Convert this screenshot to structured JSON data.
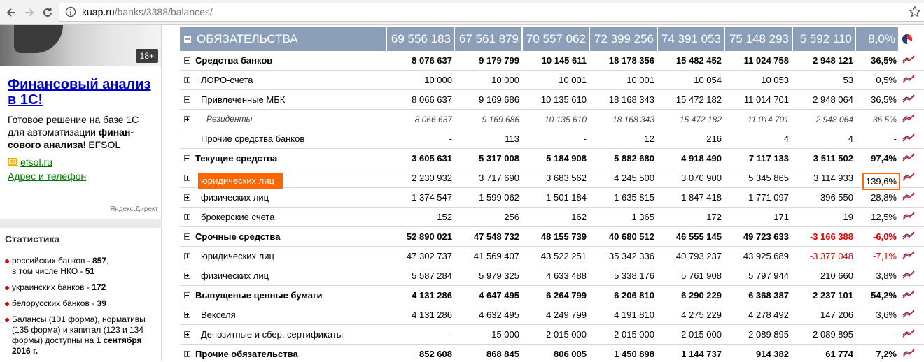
{
  "browser": {
    "url_host": "kuap.ru",
    "url_path": "/banks/3388/balances/"
  },
  "ad": {
    "age_badge": "18+",
    "title": "Финансовый анализ в 1С!",
    "text_1": "Готовое решение на базе 1С для автоматизации ",
    "text_bold": "финан-сового анализа",
    "text_2": "! EFSOL",
    "domain": "efsol.ru",
    "contacts": "Адрес и телефон",
    "label": "Яндекс.Директ"
  },
  "stats": {
    "title": "Статистика",
    "items": [
      {
        "text": "российских банков - ",
        "bold": "857",
        "text2": ",",
        "line2": "в том числе НКО - ",
        "bold2": "51"
      },
      {
        "text": "украинских банков - ",
        "bold": "172"
      },
      {
        "text": "белорусских банков - ",
        "bold": "39"
      },
      {
        "text": "Балансы (101 форма), нормативы (135 форма) и капитал (123 и 134 формы) доступны на ",
        "bold": "1 сентября 2016 г."
      }
    ]
  },
  "table": {
    "header": {
      "title": "ОБЯЗАТЕЛЬСТВА",
      "values": [
        "69 556 183",
        "67 561 879",
        "70 557 062",
        "72 399 256",
        "74 391 053",
        "75 148 293",
        "5 592 110",
        "8,0%"
      ]
    },
    "rows": [
      {
        "label": "Средства банков",
        "values": [
          "8 076 637",
          "9 179 799",
          "10 145 611",
          "18 178 356",
          "15 482 452",
          "11 024 758",
          "2 948 121",
          "36,5%"
        ]
      },
      {
        "label": "ЛОРО-счета",
        "values": [
          "10 000",
          "10 000",
          "10 001",
          "10 001",
          "10 054",
          "10 053",
          "53",
          "0,5%"
        ]
      },
      {
        "label": "Привлеченные МБК",
        "values": [
          "8 066 637",
          "9 169 686",
          "10 135 610",
          "18 168 343",
          "15 472 182",
          "11 014 701",
          "2 948 064",
          "36,5%"
        ]
      },
      {
        "label": "Резиденты",
        "values": [
          "8 066 637",
          "9 169 686",
          "10 135 610",
          "18 168 343",
          "15 472 182",
          "11 014 701",
          "2 948 064",
          "36,5%"
        ]
      },
      {
        "label": "Прочие средства банков",
        "values": [
          "-",
          "113",
          "-",
          "12",
          "216",
          "4",
          "4",
          "-"
        ]
      },
      {
        "label": "Текущие средства",
        "values": [
          "3 605 631",
          "5 317 008",
          "5 184 908",
          "5 882 680",
          "4 918 490",
          "7 117 133",
          "3 511 502",
          "97,4%"
        ]
      },
      {
        "label": "юридических лиц",
        "values": [
          "2 230 932",
          "3 717 690",
          "3 683 562",
          "4 245 500",
          "3 070 900",
          "5 345 865",
          "3 114 933",
          "139,6%"
        ]
      },
      {
        "label": "физических лиц",
        "values": [
          "1 374 547",
          "1 599 062",
          "1 501 184",
          "1 635 815",
          "1 847 418",
          "1 771 097",
          "396 550",
          "28,8%"
        ]
      },
      {
        "label": "брокерские счета",
        "values": [
          "152",
          "256",
          "162",
          "1 365",
          "172",
          "171",
          "19",
          "12,5%"
        ]
      },
      {
        "label": "Срочные средства",
        "values": [
          "52 890 021",
          "47 548 732",
          "48 155 739",
          "40 680 512",
          "46 555 145",
          "49 723 633",
          "-3 166 388",
          "-6,0%"
        ]
      },
      {
        "label": "юридических лиц",
        "values": [
          "47 302 737",
          "41 569 407",
          "43 522 251",
          "35 342 336",
          "40 793 237",
          "43 925 689",
          "-3 377 048",
          "-7,1%"
        ]
      },
      {
        "label": "физических лиц",
        "values": [
          "5 587 284",
          "5 979 325",
          "4 633 488",
          "5 338 176",
          "5 761 908",
          "5 797 944",
          "210 660",
          "3,8%"
        ]
      },
      {
        "label": "Выпущеные ценные бумаги",
        "values": [
          "4 131 286",
          "4 647 495",
          "6 264 799",
          "6 206 810",
          "6 290 229",
          "6 368 387",
          "2 237 101",
          "54,2%"
        ]
      },
      {
        "label": "Векселя",
        "values": [
          "4 131 286",
          "4 632 495",
          "4 249 799",
          "4 191 810",
          "4 275 229",
          "4 278 492",
          "147 206",
          "3,6%"
        ]
      },
      {
        "label": "Депозитные и сбер. сертификаты",
        "values": [
          "-",
          "15 000",
          "2 015 000",
          "2 015 000",
          "2 015 000",
          "2 089 895",
          "2 089 895",
          "-"
        ]
      },
      {
        "label": "Прочие обязательства",
        "values": [
          "852 608",
          "868 845",
          "806 005",
          "1 450 898",
          "1 144 737",
          "914 382",
          "61 774",
          "7,2%"
        ]
      }
    ]
  },
  "colors": {
    "header_bg": "#8c9eb8",
    "highlight": "#ff6600",
    "negative": "#e00000"
  }
}
